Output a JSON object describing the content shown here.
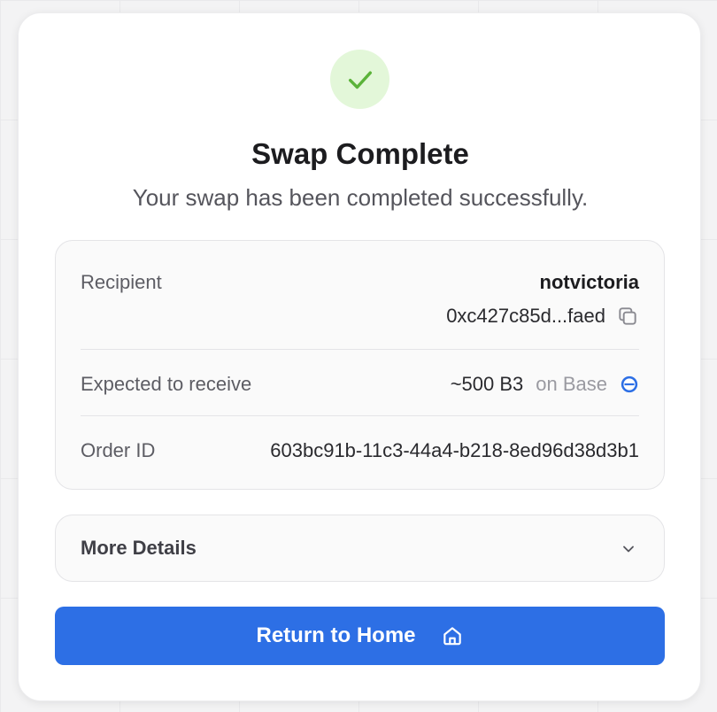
{
  "modal": {
    "title": "Swap Complete",
    "subtitle": "Your swap has been completed successfully."
  },
  "summary": {
    "recipient_label": "Recipient",
    "recipient_name": "notvictoria",
    "recipient_address": "0xc427c85d...faed",
    "receive_label": "Expected to receive",
    "receive_amount": "~500 B3",
    "receive_chain": "on Base",
    "order_label": "Order ID",
    "order_id": "603bc91b-11c3-44a4-b218-8ed96d38d3b1"
  },
  "details": {
    "label": "More Details"
  },
  "actions": {
    "return_label": "Return to Home"
  },
  "icons": {
    "success": "check-icon",
    "copy": "copy-icon",
    "chain": "base-chain-icon",
    "expand": "chevron-down-icon",
    "home": "home-icon"
  },
  "colors": {
    "accent": "#2d6fe5",
    "success_bg": "#e3f7d9",
    "success_fg": "#5bb33a",
    "base_chain": "#2d6fe5"
  }
}
